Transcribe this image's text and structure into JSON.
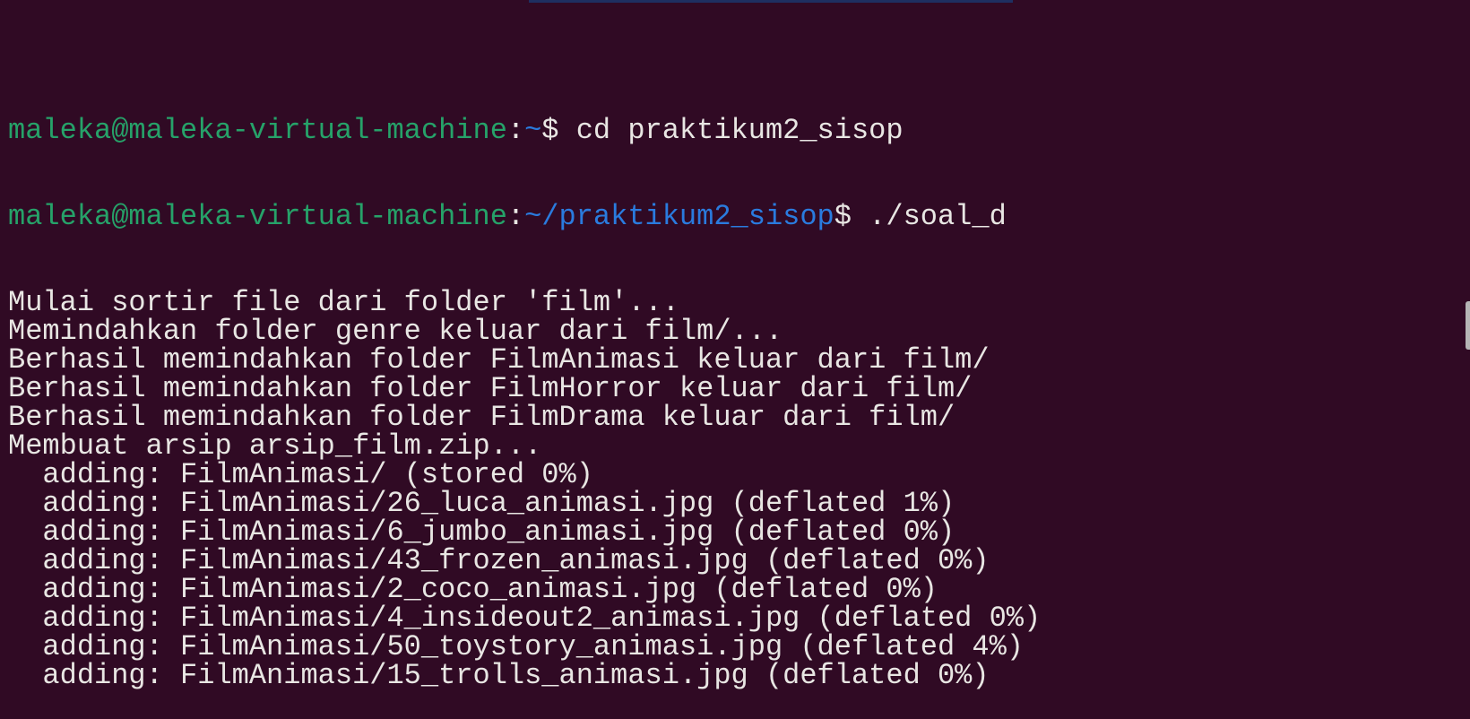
{
  "terminal": {
    "prompts": [
      {
        "user_host": "maleka@maleka-virtual-machine",
        "path": "~",
        "command": "cd praktikum2_sisop"
      },
      {
        "user_host": "maleka@maleka-virtual-machine",
        "path": "~/praktikum2_sisop",
        "command": "./soal_d"
      }
    ],
    "output": [
      "Mulai sortir file dari folder 'film'...",
      "Memindahkan folder genre keluar dari film/...",
      "Berhasil memindahkan folder FilmAnimasi keluar dari film/",
      "Berhasil memindahkan folder FilmHorror keluar dari film/",
      "Berhasil memindahkan folder FilmDrama keluar dari film/",
      "Membuat arsip arsip_film.zip...",
      "  adding: FilmAnimasi/ (stored 0%)",
      "  adding: FilmAnimasi/26_luca_animasi.jpg (deflated 1%)",
      "  adding: FilmAnimasi/6_jumbo_animasi.jpg (deflated 0%)",
      "  adding: FilmAnimasi/43_frozen_animasi.jpg (deflated 0%)",
      "  adding: FilmAnimasi/2_coco_animasi.jpg (deflated 0%)",
      "  adding: FilmAnimasi/4_insideout2_animasi.jpg (deflated 0%)",
      "  adding: FilmAnimasi/50_toystory_animasi.jpg (deflated 4%)",
      "  adding: FilmAnimasi/15_trolls_animasi.jpg (deflated 0%)"
    ]
  }
}
